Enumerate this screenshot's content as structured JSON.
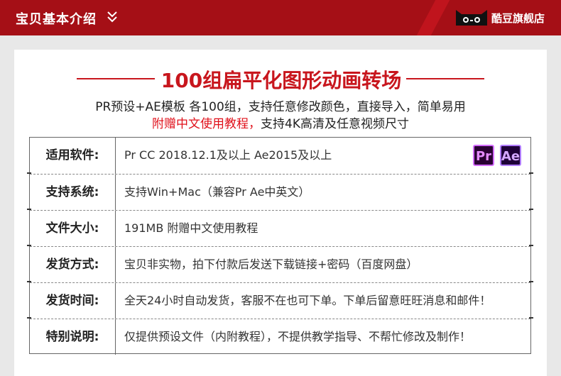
{
  "header": {
    "title": "宝贝基本介绍",
    "brand_name": "酷豆旗舰店",
    "colors": {
      "bar": "#a50f16",
      "accent": "#c8161d"
    }
  },
  "headline": "100组扁平化图形动画转场",
  "subtitle_line1": "PR预设+AE模板 各100组，支持任意修改颜色，直接导入，简单易用",
  "subtitle_line2_red": "附赠中文使用教程，",
  "subtitle_line2_rest": "支持4K高清及任意视频尺寸",
  "specs": [
    {
      "label": "适用软件:",
      "value": "Pr CC 2018.12.1及以上   Ae2015及以上"
    },
    {
      "label": "支持系统:",
      "value": "支持Win+Mac（兼容Pr Ae中英文）"
    },
    {
      "label": "文件大小:",
      "value": "191MB     附赠中文使用教程"
    },
    {
      "label": "发货方式:",
      "value": "宝贝非实物，拍下付款后发送下载链接+密码（百度网盘）"
    },
    {
      "label": "发货时间:",
      "value": "全天24小时自动发货，客服不在也可下单。下单后留意旺旺消息和邮件！"
    },
    {
      "label": "特别说明:",
      "value": "仅提供预设文件（内附教程），不提供教学指导、不帮忙修改及制作！"
    }
  ],
  "badges": {
    "pr": "Pr",
    "ae": "Ae"
  },
  "icons": [
    "chevron-down-icon",
    "tmall-cat-icon",
    "premiere-pro-icon",
    "after-effects-icon"
  ]
}
